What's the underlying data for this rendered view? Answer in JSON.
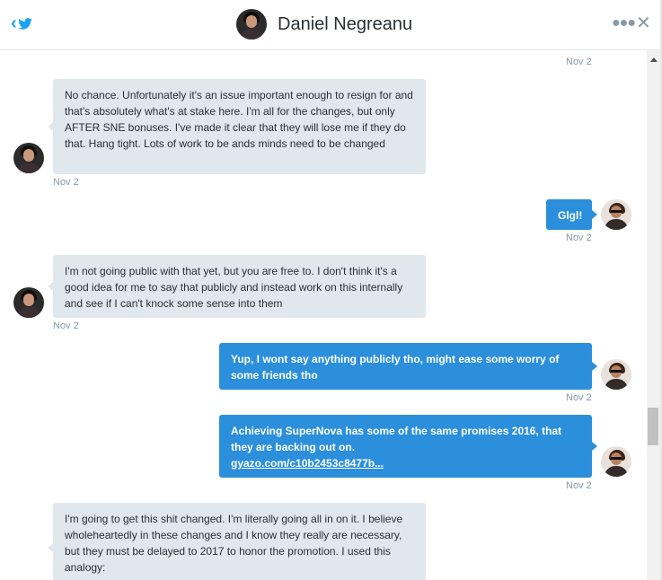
{
  "header": {
    "name": "Daniel Negreanu"
  },
  "icons": {
    "back": "chevron-left-icon",
    "brand": "twitter-bird-icon",
    "more": "more-dots-icon",
    "close": "close-icon"
  },
  "colors": {
    "accent": "#1da1f2",
    "sent_bubble": "#2b8fdb",
    "received_bubble": "#e1e8ed",
    "timestamp": "#8899a6"
  },
  "messages": [
    {
      "direction": "sent",
      "timestamp": "Nov 2"
    },
    {
      "direction": "received",
      "text": "No chance. Unfortunately it's an issue important enough to resign for and that's absolutely what's at stake here. I'm all for the changes, but only AFTER SNE bonuses. I've made it clear that they will lose me if they do that. Hang tight. Lots of work to be ands minds need to be changed",
      "timestamp": "Nov 2"
    },
    {
      "direction": "sent",
      "text": "Glgl!",
      "timestamp": "Nov 2"
    },
    {
      "direction": "received",
      "text": "I'm not going public with that yet, but you are free to. I don't think it's a good idea for me to say that publicly and instead work on this internally and see if I can't knock some sense into them",
      "timestamp": "Nov 2"
    },
    {
      "direction": "sent",
      "text": "Yup, I wont say anything publicly tho, might ease some worry of some friends tho",
      "timestamp": "Nov 2"
    },
    {
      "direction": "sent",
      "text": "Achieving SuperNova has some of the same promises 2016, that they are backing out on.",
      "link": "gyazo.com/c10b2453c8477b...",
      "timestamp": "Nov 2"
    },
    {
      "direction": "received",
      "text": "I'm going to get this shit changed. I'm literally going all in on it. I believe wholeheartedly in these changes and I know they really are necessary, but they must be delayed to 2017 to honor the promotion. I used this analogy:"
    }
  ]
}
